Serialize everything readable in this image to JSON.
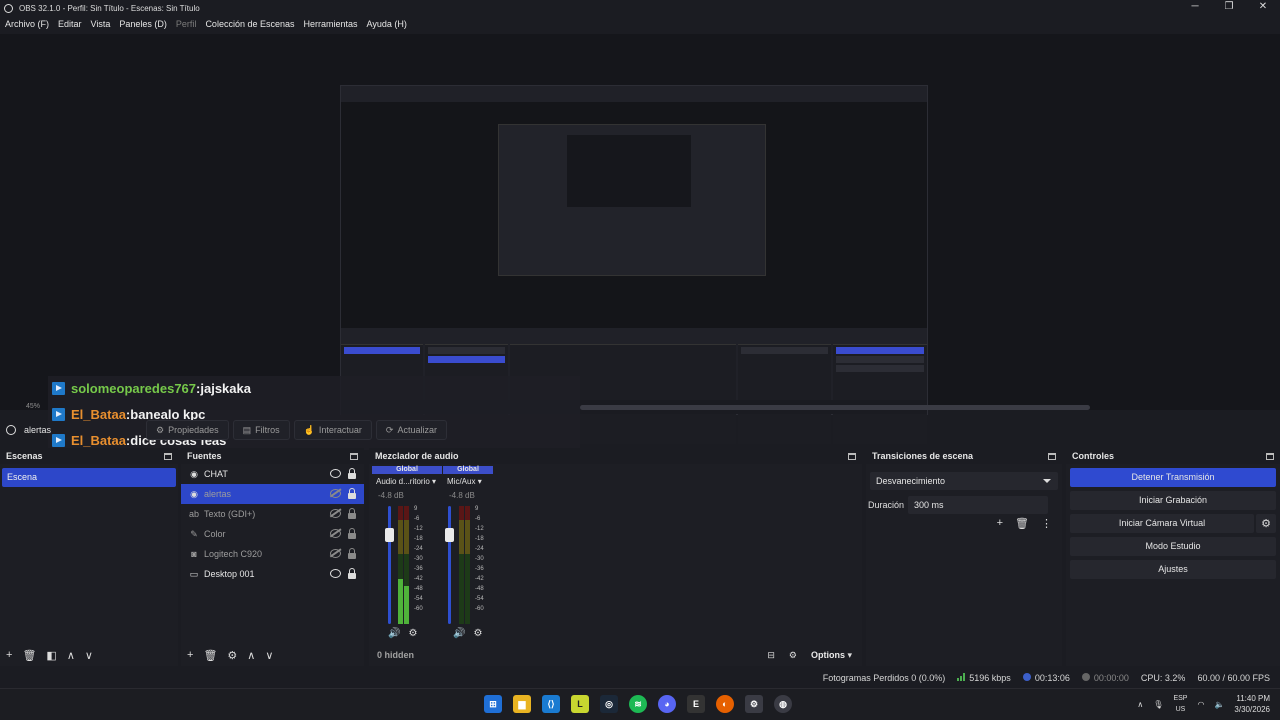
{
  "window": {
    "title": "OBS 32.1.0 - Perfil: Sin Título - Escenas: Sin Título",
    "controls": {
      "minimize": "─",
      "restore": "❐",
      "close": "✕"
    }
  },
  "menu": [
    "Archivo (F)",
    "Editar",
    "Vista",
    "Paneles (D)",
    "Perfil",
    "Colección de Escenas",
    "Herramientas",
    "Ayuda (H)"
  ],
  "chat": [
    {
      "user": "solomeoparedes767",
      "sep": " : ",
      "msg": "jajskaka"
    },
    {
      "user": "El_Bataa",
      "sep": " : ",
      "msg": "banealo kpc"
    },
    {
      "user": "El_Bataa",
      "sep": " : ",
      "msg": "dice cosas feas"
    }
  ],
  "preview": {
    "zoom": "45%"
  },
  "source_toolbar": {
    "selected": "alertas",
    "buttons": {
      "properties": "Propiedades",
      "filters": "Filtros",
      "interact": "Interactuar",
      "refresh": "Actualizar"
    }
  },
  "scenes": {
    "title": "Escenas",
    "items": [
      "Escena"
    ]
  },
  "sources": {
    "title": "Fuentes",
    "items": [
      {
        "label": "CHAT",
        "icon": "browser-icon"
      },
      {
        "label": "alertas",
        "icon": "browser-icon"
      },
      {
        "label": "Texto (GDI+)",
        "icon": "text-icon"
      },
      {
        "label": "Color",
        "icon": "color-icon"
      },
      {
        "label": "Logitech C920",
        "icon": "camera-icon"
      },
      {
        "label": "Desktop 001",
        "icon": "monitor-icon"
      }
    ]
  },
  "mixer": {
    "title": "Mezclador de audio",
    "channels": [
      {
        "tag": "Global",
        "name": "Audio d...ritorio",
        "db": "-4.8 dB"
      },
      {
        "tag": "Global",
        "name": "Mic/Aux",
        "db": "-4.8 dB"
      }
    ],
    "ticks": [
      "9",
      "-6",
      "-12",
      "-18",
      "-24",
      "-30",
      "-36",
      "-42",
      "-48",
      "-54",
      "-60"
    ],
    "hidden": "0 hidden",
    "options": "Options"
  },
  "transitions": {
    "title": "Transiciones de escena",
    "selected": "Desvanecimiento",
    "duration_label": "Duración",
    "duration_value": "300 ms"
  },
  "controls": {
    "title": "Controles",
    "stop_stream": "Detener Transmisión",
    "start_recording": "Iniciar Grabación",
    "virtual_camera": "Iniciar Cámara Virtual",
    "studio_mode": "Modo Estudio",
    "settings": "Ajustes"
  },
  "status": {
    "dropped": "Fotogramas Perdidos 0 (0.0%)",
    "bitrate": "5196 kbps",
    "stream_time": "00:13:06",
    "rec_time": "00:00:00",
    "cpu": "CPU: 3.2%",
    "fps": "60.00 / 60.00 FPS"
  },
  "taskbar": {
    "lang_top": "ESP",
    "lang_bottom": "US",
    "time": "11:40 PM",
    "date": "3/30/2026"
  },
  "colors": {
    "accent": "#2f4ad0",
    "chat_user1": "#76c94a",
    "chat_user2": "#e88f2f"
  }
}
